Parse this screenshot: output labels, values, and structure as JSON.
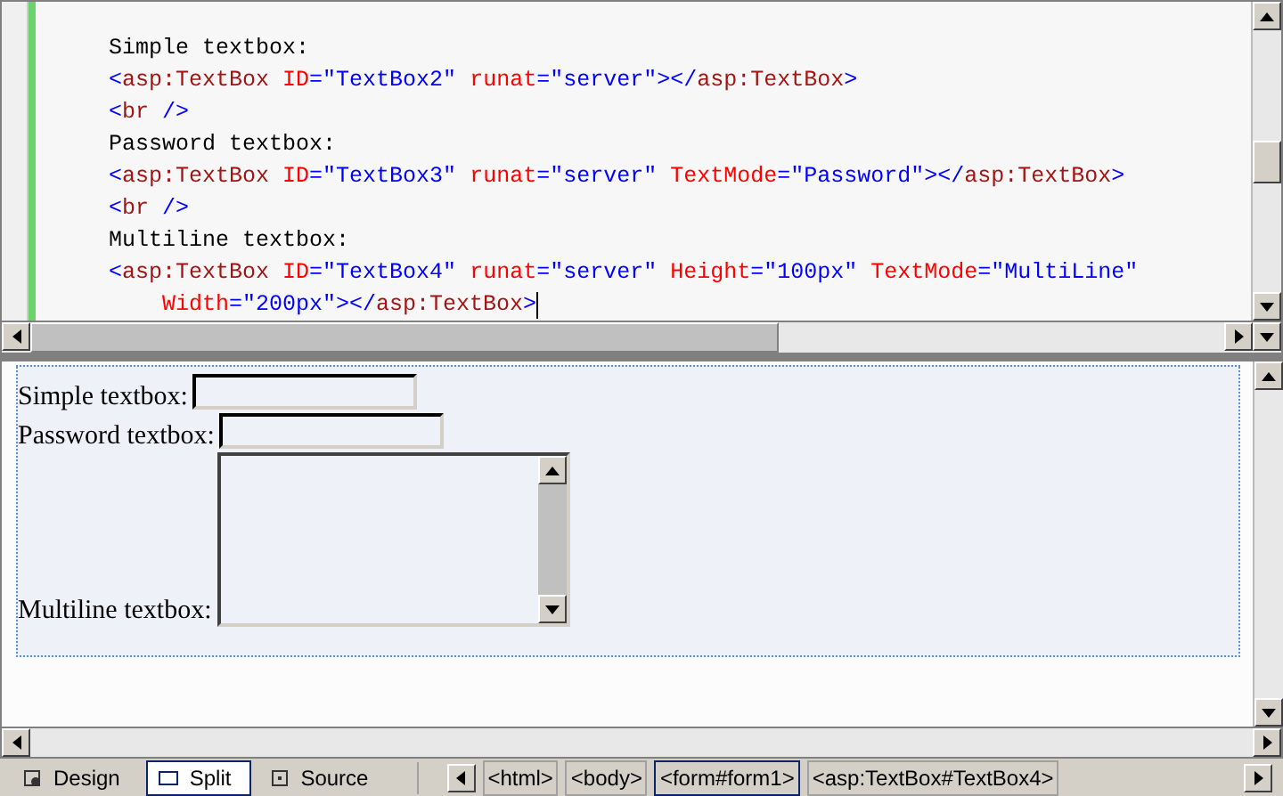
{
  "code_lines": [
    {
      "segments": [
        {
          "kind": "text",
          "text": "Simple textbox:"
        }
      ]
    },
    {
      "segments": [
        {
          "kind": "punct",
          "text": "<"
        },
        {
          "kind": "tag",
          "text": "asp:TextBox"
        },
        {
          "kind": "attr",
          "text": " ID"
        },
        {
          "kind": "punct",
          "text": "=\"TextBox2\""
        },
        {
          "kind": "attr",
          "text": " runat"
        },
        {
          "kind": "punct",
          "text": "=\"server\"></"
        },
        {
          "kind": "tag",
          "text": "asp:TextBox"
        },
        {
          "kind": "punct",
          "text": ">"
        }
      ]
    },
    {
      "segments": [
        {
          "kind": "punct",
          "text": "<"
        },
        {
          "kind": "tag",
          "text": "br"
        },
        {
          "kind": "punct",
          "text": " />"
        }
      ]
    },
    {
      "segments": [
        {
          "kind": "text",
          "text": "Password textbox:"
        }
      ]
    },
    {
      "segments": [
        {
          "kind": "punct",
          "text": "<"
        },
        {
          "kind": "tag",
          "text": "asp:TextBox"
        },
        {
          "kind": "attr",
          "text": " ID"
        },
        {
          "kind": "punct",
          "text": "=\"TextBox3\""
        },
        {
          "kind": "attr",
          "text": " runat"
        },
        {
          "kind": "punct",
          "text": "=\"server\""
        },
        {
          "kind": "attr",
          "text": " TextMode"
        },
        {
          "kind": "punct",
          "text": "=\"Password\"></"
        },
        {
          "kind": "tag",
          "text": "asp:TextBox"
        },
        {
          "kind": "punct",
          "text": ">"
        }
      ]
    },
    {
      "segments": [
        {
          "kind": "punct",
          "text": "<"
        },
        {
          "kind": "tag",
          "text": "br"
        },
        {
          "kind": "punct",
          "text": " />"
        }
      ]
    },
    {
      "segments": [
        {
          "kind": "text",
          "text": "Multiline textbox:"
        }
      ]
    },
    {
      "segments": [
        {
          "kind": "punct",
          "text": "<"
        },
        {
          "kind": "tag",
          "text": "asp:TextBox"
        },
        {
          "kind": "attr",
          "text": " ID"
        },
        {
          "kind": "punct",
          "text": "=\"TextBox4\""
        },
        {
          "kind": "attr",
          "text": " runat"
        },
        {
          "kind": "punct",
          "text": "=\"server\""
        },
        {
          "kind": "attr",
          "text": " Height"
        },
        {
          "kind": "punct",
          "text": "=\"100px\""
        },
        {
          "kind": "attr",
          "text": " TextMode"
        },
        {
          "kind": "punct",
          "text": "=\"MultiLine\""
        }
      ]
    },
    {
      "segments": [
        {
          "kind": "attr",
          "text": "    Width"
        },
        {
          "kind": "punct",
          "text": "=\"200px\"></"
        },
        {
          "kind": "tag",
          "text": "asp:TextBox"
        },
        {
          "kind": "punct",
          "text": ">"
        }
      ]
    }
  ],
  "design_fields": [
    {
      "label": "Simple textbox:",
      "kind": "text"
    },
    {
      "label": "Password textbox:",
      "kind": "password"
    },
    {
      "label": "Multiline textbox:",
      "kind": "multiline"
    }
  ],
  "view_tabs": [
    {
      "label": "Design",
      "selected": false
    },
    {
      "label": "Split",
      "selected": true
    },
    {
      "label": "Source",
      "selected": false
    }
  ],
  "breadcrumbs": [
    {
      "label": "<html>",
      "selected": false
    },
    {
      "label": "<body>",
      "selected": false
    },
    {
      "label": "<form#form1>",
      "selected": true
    },
    {
      "label": "<asp:TextBox#TextBox4>",
      "selected": false
    }
  ]
}
